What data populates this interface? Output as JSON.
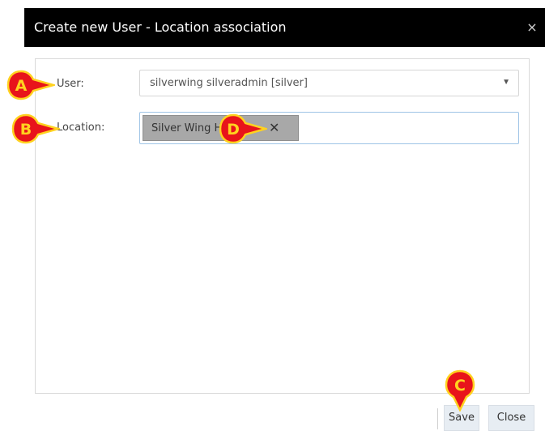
{
  "dialog": {
    "title": "Create new User - Location association",
    "close_glyph": "×"
  },
  "form": {
    "user_label": "User:",
    "user_value": "silverwing silveradmin [silver]",
    "location_label": "Location:",
    "location_tag": "Silver Wing H",
    "tag_remove_glyph": "✕",
    "select_arrow": "▼"
  },
  "footer": {
    "save_label": "Save",
    "close_label": "Close"
  },
  "annotations": {
    "markers": [
      "A",
      "B",
      "C",
      "D"
    ],
    "marker_fill": "#e8141b",
    "marker_text": "#ffd21f"
  },
  "icons": {
    "close": "close-icon",
    "dropdown": "chevron-down-icon",
    "remove": "remove-tag-icon"
  }
}
